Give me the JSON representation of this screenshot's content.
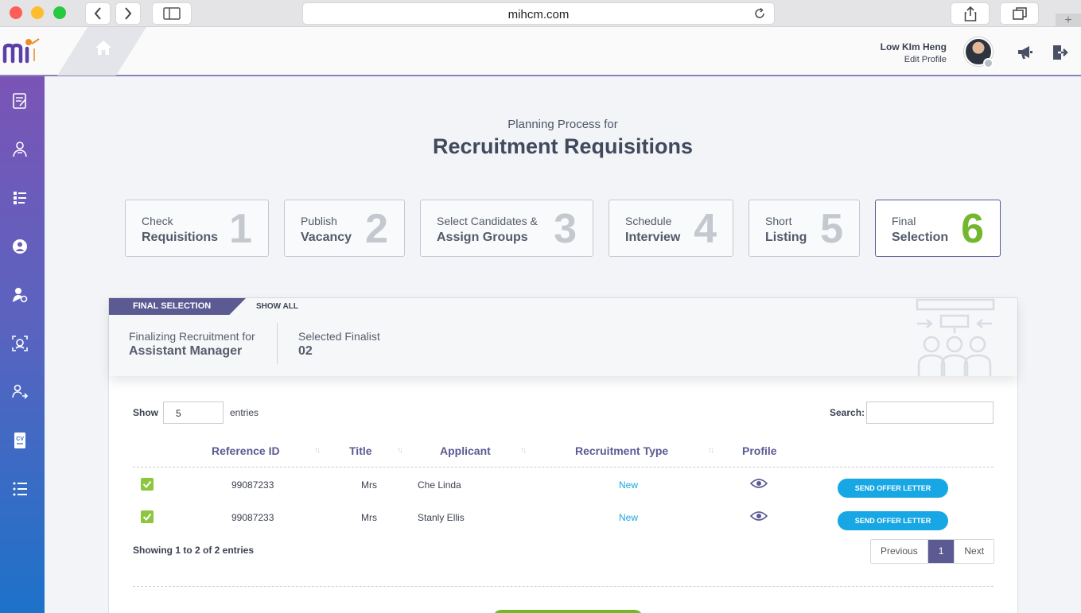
{
  "browser": {
    "url": "mihcm.com",
    "new_tab_symbol": "+"
  },
  "header": {
    "user_name": "Low KIm Heng",
    "edit_profile": "Edit Profile"
  },
  "page": {
    "subtitle": "Planning Process for",
    "title": "Recruitment Requisitions"
  },
  "steps": [
    {
      "line1": "Check",
      "line2": "Requisitions",
      "number": "1"
    },
    {
      "line1": "Publish",
      "line2": "Vacancy",
      "number": "2"
    },
    {
      "line1": "Select Candidates &",
      "line2": "Assign Groups",
      "number": "3"
    },
    {
      "line1": "Schedule",
      "line2": "Interview",
      "number": "4"
    },
    {
      "line1": "Short",
      "line2": "Listing",
      "number": "5"
    },
    {
      "line1": "Final",
      "line2": "Selection",
      "number": "6"
    }
  ],
  "panel": {
    "tag": "FINAL SELECTION",
    "show_all": "SHOW ALL",
    "finalizing_label": "Finalizing Recruitment for",
    "finalizing_value": "Assistant Manager",
    "finalist_label": "Selected Finalist",
    "finalist_value": "02"
  },
  "table_controls": {
    "show": "Show",
    "entries_value": "5",
    "entries": "entries",
    "search": "Search:"
  },
  "table": {
    "headers": [
      "Reference ID",
      "Title",
      "Applicant",
      "Recruitment Type",
      "Profile"
    ],
    "rows": [
      {
        "ref": "99087233",
        "title": "Mrs",
        "applicant": "Che Linda",
        "type": "New",
        "action": "SEND OFFER LETTER"
      },
      {
        "ref": "99087233",
        "title": "Mrs",
        "applicant": "Stanly Ellis",
        "type": "New",
        "action": "SEND OFFER LETTER"
      }
    ]
  },
  "footer": {
    "showing": "Showing 1 to 2 of 2 entries",
    "previous": "Previous",
    "page": "1",
    "next": "Next"
  },
  "colors": {
    "accent": "#5b5a93",
    "active_step": "#74b72e",
    "offer_button": "#17a7e4"
  }
}
